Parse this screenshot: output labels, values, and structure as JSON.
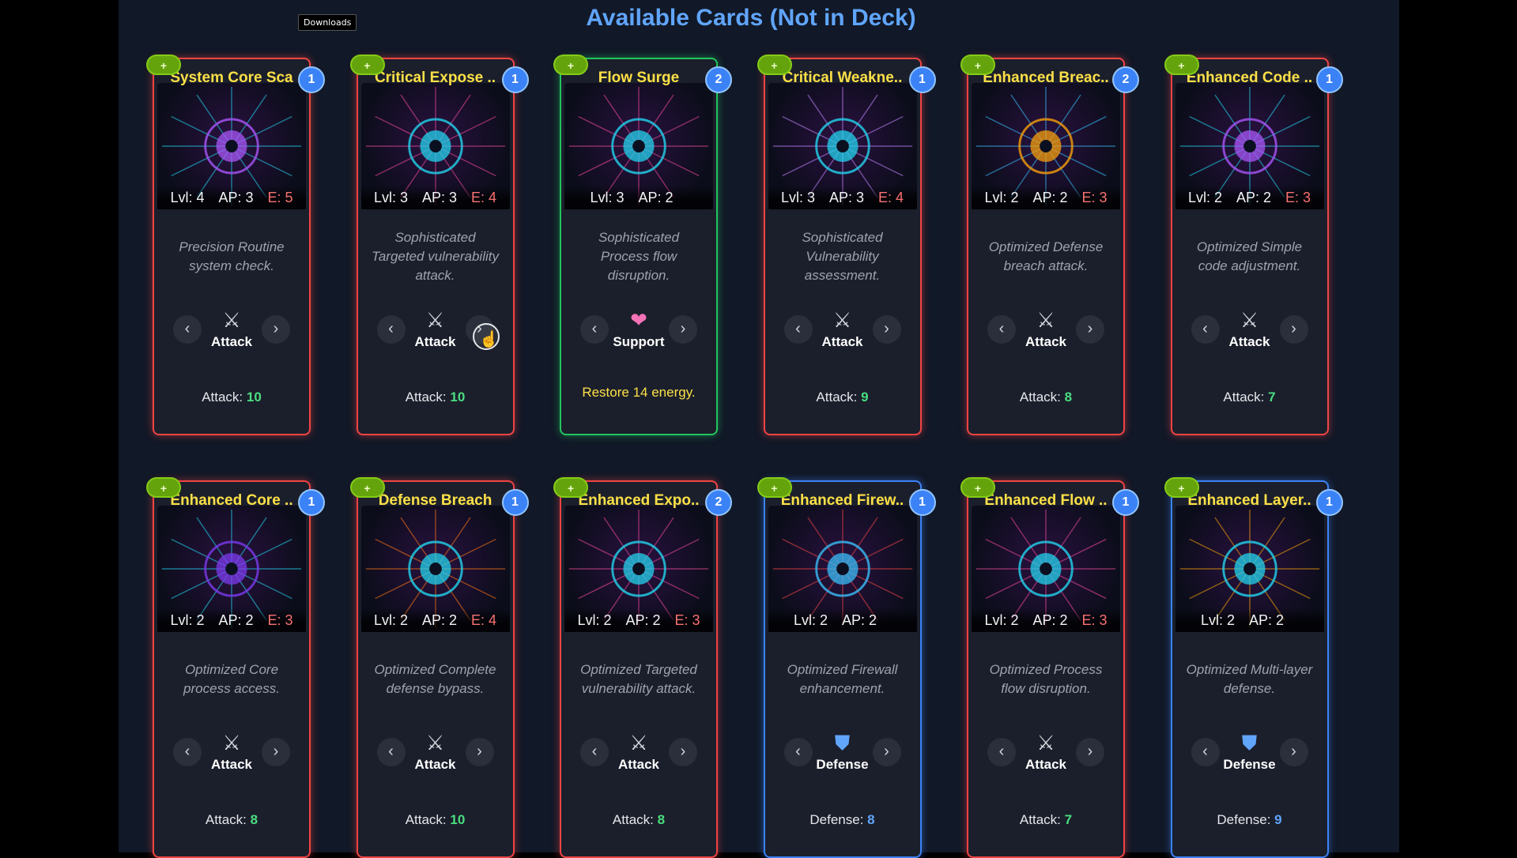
{
  "tooltip": "Downloads",
  "page_title": "Available Cards (Not in Deck)",
  "add_button_label": "+",
  "colors": {
    "attack": "#ef4444",
    "support": "#22c55e",
    "defense": "#3b82f6"
  },
  "cards": [
    {
      "name": "System Core Sca",
      "count": "1",
      "lvl": "Lvl: 4",
      "ap": "AP: 3",
      "energy": "E: 5",
      "desc": "Precision Routine system check.",
      "type": "Attack",
      "type_icon": "crossed-swords-icon",
      "effect_label": "Attack:",
      "effect_value": "10",
      "effect_text": ""
    },
    {
      "name": "Critical Expose ..",
      "count": "1",
      "lvl": "Lvl: 3",
      "ap": "AP: 3",
      "energy": "E: 4",
      "desc": "Sophisticated Targeted vulnerability attack.",
      "type": "Attack",
      "type_icon": "crossed-swords-icon",
      "effect_label": "Attack:",
      "effect_value": "10",
      "effect_text": ""
    },
    {
      "name": "Flow Surge",
      "count": "2",
      "lvl": "Lvl: 3",
      "ap": "AP: 2",
      "energy": "",
      "desc": "Sophisticated Process flow disruption.",
      "type": "Support",
      "type_icon": "heart-icon",
      "effect_label": "",
      "effect_value": "",
      "effect_text": "Restore 14 energy."
    },
    {
      "name": "Critical Weakne..",
      "count": "1",
      "lvl": "Lvl: 3",
      "ap": "AP: 3",
      "energy": "E: 4",
      "desc": "Sophisticated Vulnerability assessment.",
      "type": "Attack",
      "type_icon": "crossed-swords-icon",
      "effect_label": "Attack:",
      "effect_value": "9",
      "effect_text": ""
    },
    {
      "name": "Enhanced Breac..",
      "count": "2",
      "lvl": "Lvl: 2",
      "ap": "AP: 2",
      "energy": "E: 3",
      "desc": "Optimized Defense breach attack.",
      "type": "Attack",
      "type_icon": "crossed-swords-icon",
      "effect_label": "Attack:",
      "effect_value": "8",
      "effect_text": ""
    },
    {
      "name": "Enhanced Code ..",
      "count": "1",
      "lvl": "Lvl: 2",
      "ap": "AP: 2",
      "energy": "E: 3",
      "desc": "Optimized Simple code adjustment.",
      "type": "Attack",
      "type_icon": "crossed-swords-icon",
      "effect_label": "Attack:",
      "effect_value": "7",
      "effect_text": ""
    },
    {
      "name": "Enhanced Core ..",
      "count": "1",
      "lvl": "Lvl: 2",
      "ap": "AP: 2",
      "energy": "E: 3",
      "desc": "Optimized Core process access.",
      "type": "Attack",
      "type_icon": "crossed-swords-icon",
      "effect_label": "Attack:",
      "effect_value": "8",
      "effect_text": ""
    },
    {
      "name": "Defense Breach",
      "count": "1",
      "lvl": "Lvl: 2",
      "ap": "AP: 2",
      "energy": "E: 4",
      "desc": "Optimized Complete defense bypass.",
      "type": "Attack",
      "type_icon": "crossed-swords-icon",
      "effect_label": "Attack:",
      "effect_value": "10",
      "effect_text": ""
    },
    {
      "name": "Enhanced Expo..",
      "count": "2",
      "lvl": "Lvl: 2",
      "ap": "AP: 2",
      "energy": "E: 3",
      "desc": "Optimized Targeted vulnerability attack.",
      "type": "Attack",
      "type_icon": "crossed-swords-icon",
      "effect_label": "Attack:",
      "effect_value": "8",
      "effect_text": ""
    },
    {
      "name": "Enhanced Firew..",
      "count": "1",
      "lvl": "Lvl: 2",
      "ap": "AP: 2",
      "energy": "",
      "desc": "Optimized Firewall enhancement.",
      "type": "Defense",
      "type_icon": "shield-icon",
      "effect_label": "Defense:",
      "effect_value": "8",
      "effect_text": ""
    },
    {
      "name": "Enhanced Flow ..",
      "count": "1",
      "lvl": "Lvl: 2",
      "ap": "AP: 2",
      "energy": "E: 3",
      "desc": "Optimized Process flow disruption.",
      "type": "Attack",
      "type_icon": "crossed-swords-icon",
      "effect_label": "Attack:",
      "effect_value": "7",
      "effect_text": ""
    },
    {
      "name": "Enhanced Layer..",
      "count": "1",
      "lvl": "Lvl: 2",
      "ap": "AP: 2",
      "energy": "",
      "desc": "Optimized Multi-layer defense.",
      "type": "Defense",
      "type_icon": "shield-icon",
      "effect_label": "Defense:",
      "effect_value": "9",
      "effect_text": ""
    }
  ]
}
